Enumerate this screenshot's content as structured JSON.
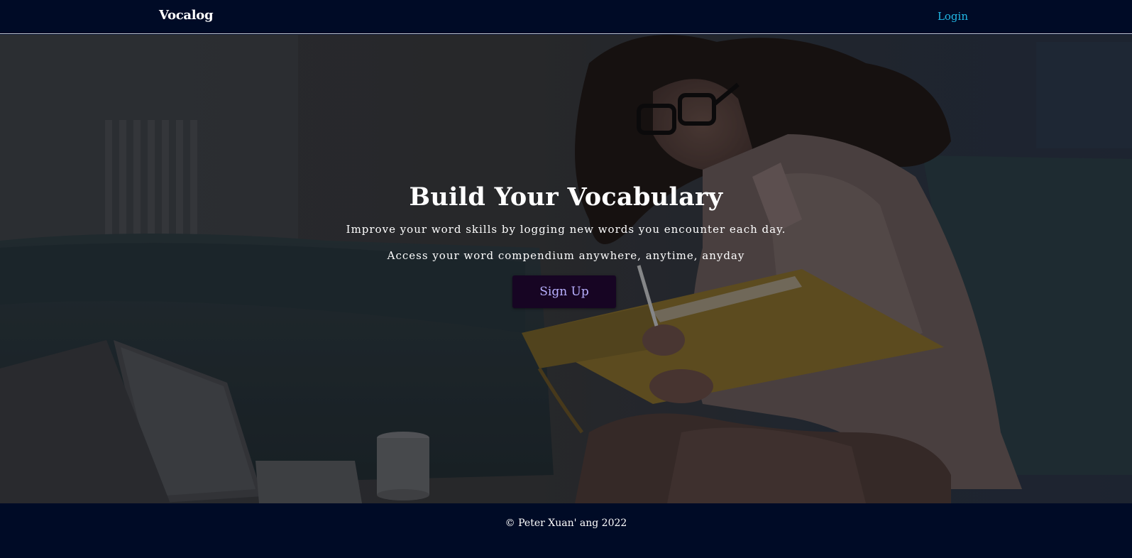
{
  "navbar": {
    "brand": "Vocalog",
    "login_label": "Login"
  },
  "hero": {
    "title": "Build Your Vocabulary",
    "line1": "Improve your word skills by logging new words you encounter each day.",
    "line2": "Access your word compendium anywhere, anytime, anyday",
    "signup_label": "Sign Up",
    "background_image": "woman-writing-in-notebook-photo"
  },
  "footer": {
    "copyright": "© Peter Xuan' ang 2022"
  },
  "colors": {
    "nav_bg": "#000b26",
    "login_link": "#22b9e6",
    "signup_bg": "#170523",
    "signup_text": "#b8b0ff"
  }
}
